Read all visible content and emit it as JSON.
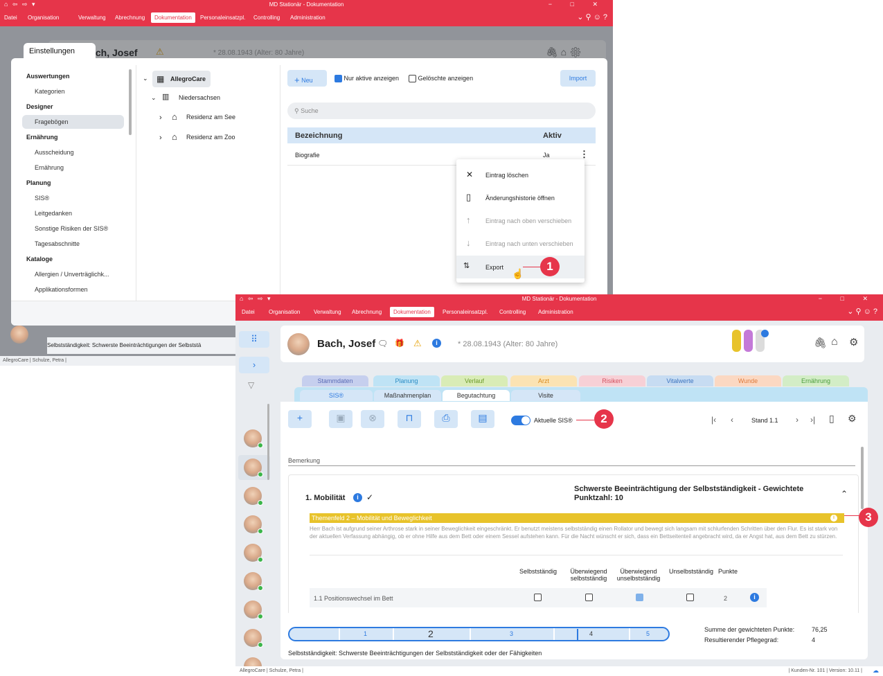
{
  "win1": {
    "title": "MD Stationär - Dokumentation",
    "menu": [
      "Datei",
      "Organisation",
      "Verwaltung",
      "Abrechnung",
      "Dokumentation",
      "Personaleinsatzpl.",
      "Controlling",
      "Administration"
    ],
    "patient_name": "Bach, Josef",
    "birth": "* 28.08.1943 (Alter: 80 Jahre)",
    "settings_tab": "Einstellungen",
    "nav": [
      {
        "label": "Auswertungen",
        "type": "header"
      },
      {
        "label": "Kategorien",
        "type": "item"
      },
      {
        "label": "Designer",
        "type": "header"
      },
      {
        "label": "Fragebögen",
        "type": "item",
        "selected": true
      },
      {
        "label": "Ernährung",
        "type": "header"
      },
      {
        "label": "Ausscheidung",
        "type": "item"
      },
      {
        "label": "Ernährung",
        "type": "item"
      },
      {
        "label": "Planung",
        "type": "header"
      },
      {
        "label": "SIS®",
        "type": "item"
      },
      {
        "label": "Leitgedanken",
        "type": "item"
      },
      {
        "label": "Sonstige Risiken der SIS®",
        "type": "item"
      },
      {
        "label": "Tagesabschnitte",
        "type": "item"
      },
      {
        "label": "Kataloge",
        "type": "header"
      },
      {
        "label": "Allergien / Unverträglichk...",
        "type": "item"
      },
      {
        "label": "Applikationsformen",
        "type": "item"
      }
    ],
    "tree": {
      "root": "AllegroCare",
      "region": "Niedersachsen",
      "homes": [
        "Residenz am See",
        "Residenz am Zoo"
      ]
    },
    "toolbar": {
      "new": "Neu",
      "only_active": "Nur aktive anzeigen",
      "show_deleted": "Gelöschte anzeigen",
      "import": "Import"
    },
    "search_placeholder": "Suche",
    "table": {
      "col1": "Bezeichnung",
      "col2": "Aktiv",
      "rows": [
        {
          "name": "Biografie",
          "active": "Ja"
        }
      ]
    },
    "context_menu": [
      "Eintrag löschen",
      "Änderungshistorie öffnen",
      "Eintrag nach oben verschieben",
      "Eintrag nach unten verschieben",
      "Export"
    ],
    "bottom_text": "Selbstständigkeit: Schwerste Beeinträchtigungen der Selbststä",
    "status": "AllegroCare | Schulze, Petra |"
  },
  "win2": {
    "title": "MD Stationär - Dokumentation",
    "menu": [
      "Datei",
      "Organisation",
      "Verwaltung",
      "Abrechnung",
      "Dokumentation",
      "Personaleinsatzpl.",
      "Controlling",
      "Administration"
    ],
    "patient_name": "Bach, Josef",
    "birth": "* 28.08.1943 (Alter: 80 Jahre)",
    "tabs_row1": [
      {
        "label": "Stammdaten",
        "color": "#c6cfee",
        "text": "#5a6bb5"
      },
      {
        "label": "Planung",
        "color": "#bfe3f5",
        "text": "#2b8cc4"
      },
      {
        "label": "Verlauf",
        "color": "#d9ecb6",
        "text": "#6b9a28"
      },
      {
        "label": "Arzt",
        "color": "#fbe3b3",
        "text": "#d98a1c"
      },
      {
        "label": "Risiken",
        "color": "#f7d0d6",
        "text": "#d4505e"
      },
      {
        "label": "Vitalwerte",
        "color": "#c7dcf2",
        "text": "#3d74c0"
      },
      {
        "label": "Wunde",
        "color": "#fbd8c2",
        "text": "#e07a3a"
      },
      {
        "label": "Ernährung",
        "color": "#d3edc6",
        "text": "#4a9c3a"
      }
    ],
    "tabs_row2": [
      "SIS®",
      "Maßnahmenplan",
      "Begutachtung",
      "Visite"
    ],
    "toggle_label": "Aktuelle SIS®",
    "stand": "Stand 1.1",
    "bemerkung": "Bemerkung",
    "section_title": "1. Mobilität",
    "section_result": "Schwerste Beeinträchtigung der Selbstständigkeit - Gewichtete Punktzahl: 10",
    "themenfeld": "Themenfeld 2 – Mobilität und Beweglichkeit",
    "description": "Herr Bach ist aufgrund seiner Arthrose stark in seiner Beweglichkeit eingeschränkt. Er benutzt meistens selbstständig einen Rollator und bewegt sich langsam mit schlurfenden Schritten über den Flur. Es ist stark von der aktuellen Verfassung abhängig, ob er ohne Hilfe aus dem Bett oder einem Sessel aufstehen kann. Für die Nacht wünscht er sich, dass ein Bettseitenteil angebracht wird, da er Angst hat, aus dem Bett zu stürzen.",
    "columns": [
      "Selbstständig",
      "Überwiegend selbstständig",
      "Überwiegend unselbstständig",
      "Unselbstständig",
      "Punkte"
    ],
    "row": {
      "label": "1.1 Positionswechsel im Bett",
      "checked": 2,
      "points": "2"
    },
    "scale": [
      "1",
      "2",
      "3",
      "4",
      "5"
    ],
    "sum_label": "Summe der gewichteten Punkte:",
    "sum_value": "76,25",
    "pg_label": "Resultierender Pflegegrad:",
    "pg_value": "4",
    "footer": "Selbstständigkeit: Schwerste Beeinträchtigungen der Selbstständigkeit oder der Fähigkeiten",
    "status_left": "AllegroCare | Schulze, Petra |",
    "status_right": "| Kunden-Nr. 101 | Version: 10.11 |"
  },
  "badges": [
    "1",
    "2",
    "3"
  ],
  "colors": {
    "accent": "#e6354a",
    "blue": "#2d7ae0",
    "yellow": "#e8c32b"
  }
}
